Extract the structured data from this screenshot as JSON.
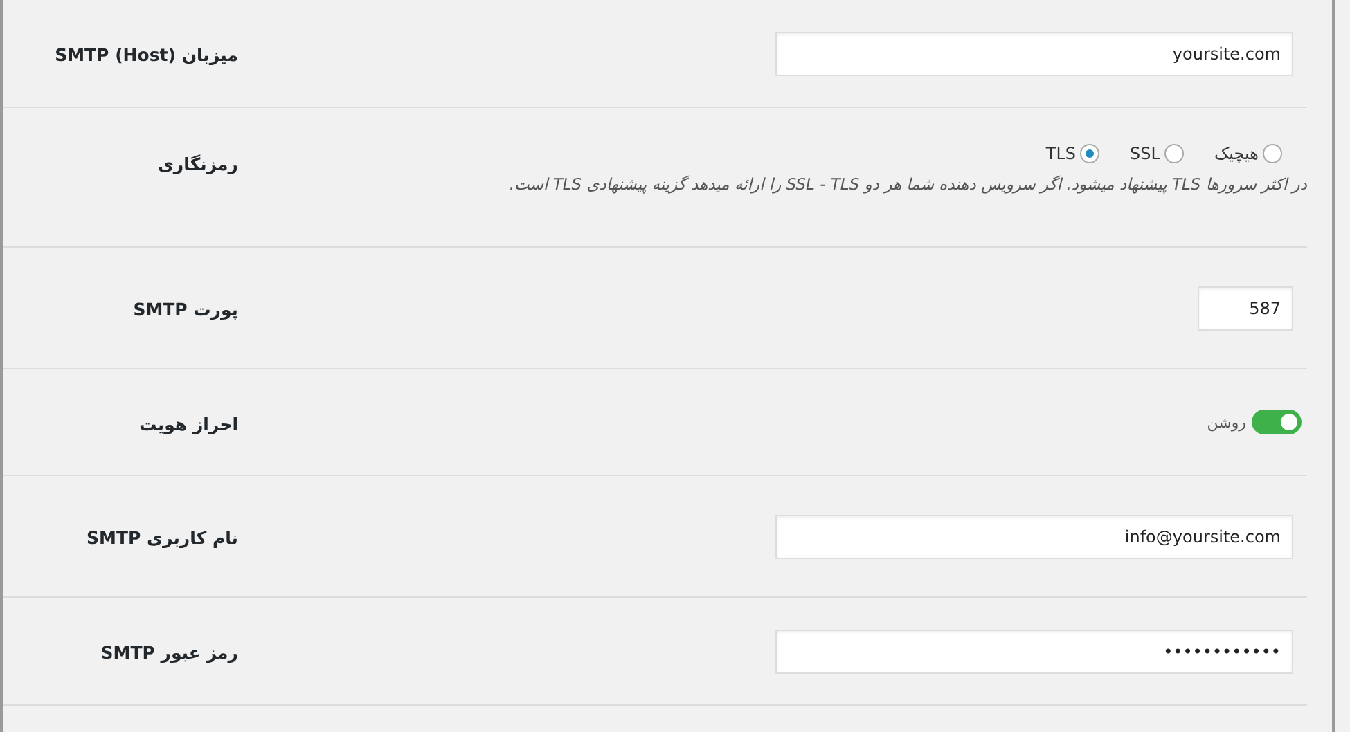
{
  "rows": [
    {
      "kind": "text",
      "label": "میزبان SMTP (Host)",
      "value": "yoursite.com"
    },
    {
      "kind": "radio",
      "label": "رمزنگاری",
      "options": [
        {
          "label": "هیچیک",
          "selected": false
        },
        {
          "label": "SSL",
          "selected": false
        },
        {
          "label": "TLS",
          "selected": true
        }
      ],
      "description": "در اکثر سرورها TLS پیشنهاد میشود. اگر سرویس دهنده شما هر دو SSL - TLS را ارائه میدهد گزینه پیشنهادی TLS است."
    },
    {
      "kind": "number",
      "label": "پورت SMTP",
      "value": "587"
    },
    {
      "kind": "toggle",
      "label": "احراز هویت",
      "on": true,
      "state_label": "روشن"
    },
    {
      "kind": "text",
      "label": "نام کاربری SMTP",
      "value": "info@yoursite.com"
    },
    {
      "kind": "text",
      "label": "رمز عبور SMTP",
      "value": "••••••••••••"
    }
  ]
}
